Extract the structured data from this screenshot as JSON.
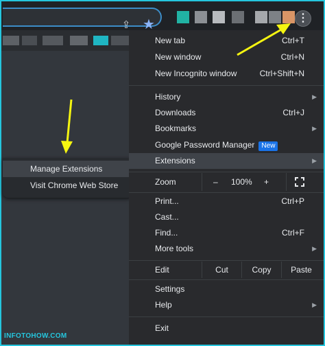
{
  "colors": {
    "accent_frame": "#25c6de",
    "annotation_arrow": "#f5f511",
    "new_badge": "#1a73e8"
  },
  "toolbar": {
    "share_icon": "share-icon",
    "star_icon": "star-icon",
    "menu_icon": "kebab-menu-icon"
  },
  "menu": {
    "new_tab": {
      "label": "New tab",
      "shortcut": "Ctrl+T"
    },
    "new_window": {
      "label": "New window",
      "shortcut": "Ctrl+N"
    },
    "new_incognito": {
      "label": "New Incognito window",
      "shortcut": "Ctrl+Shift+N"
    },
    "history": {
      "label": "History"
    },
    "downloads": {
      "label": "Downloads",
      "shortcut": "Ctrl+J"
    },
    "bookmarks": {
      "label": "Bookmarks"
    },
    "password_manager": {
      "label": "Google Password Manager",
      "badge": "New"
    },
    "extensions": {
      "label": "Extensions"
    },
    "zoom": {
      "label": "Zoom",
      "minus": "–",
      "value": "100%",
      "plus": "+"
    },
    "print": {
      "label": "Print...",
      "shortcut": "Ctrl+P"
    },
    "cast": {
      "label": "Cast..."
    },
    "find": {
      "label": "Find...",
      "shortcut": "Ctrl+F"
    },
    "more_tools": {
      "label": "More tools"
    },
    "edit": {
      "label": "Edit",
      "cut": "Cut",
      "copy": "Copy",
      "paste": "Paste"
    },
    "settings": {
      "label": "Settings"
    },
    "help": {
      "label": "Help"
    },
    "exit": {
      "label": "Exit"
    }
  },
  "submenu": {
    "manage_extensions": "Manage Extensions",
    "web_store": "Visit Chrome Web Store"
  },
  "watermark": "INFOTOHOW.COM"
}
